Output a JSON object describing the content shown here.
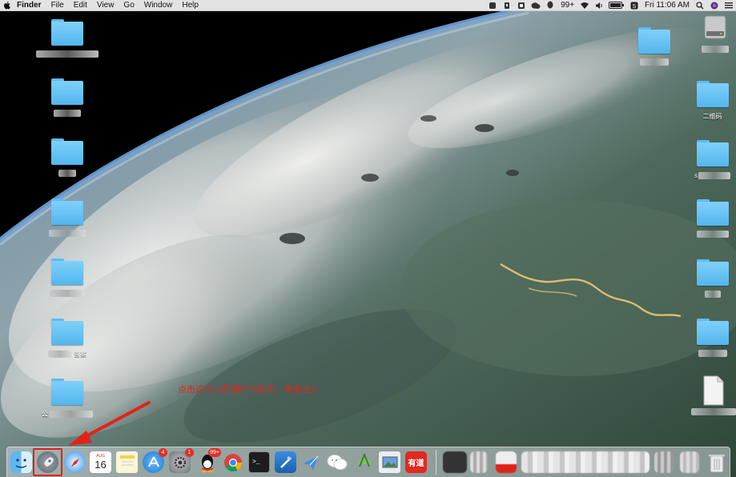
{
  "menubar": {
    "apple_icon": "apple-logo-icon",
    "app_name": "Finder",
    "menus": [
      "File",
      "Edit",
      "View",
      "Go",
      "Window",
      "Help"
    ],
    "status": {
      "notification_count": "99+",
      "battery": "",
      "clock": "Fri 11:06 AM"
    }
  },
  "desktop": {
    "left_icons": [
      {
        "label": ""
      },
      {
        "label": ""
      },
      {
        "label": ""
      },
      {
        "label": ""
      },
      {
        "label": ""
      },
      {
        "label": "备案"
      },
      {
        "label": "公"
      }
    ],
    "right_icons": [
      {
        "label": ""
      },
      {
        "label": "二维码"
      },
      {
        "label": "s"
      },
      {
        "label": ""
      },
      {
        "label": ""
      },
      {
        "label": ""
      },
      {
        "label": ""
      }
    ],
    "hard_drive_icon": "hard-drive-icon"
  },
  "annotation": {
    "text": "点击这个火箭图标的选项，单击进入",
    "color": "#e8231b"
  },
  "dock": {
    "calendar": {
      "month": "AUG",
      "day": "16"
    },
    "badges": {
      "app_store": "4",
      "system_prefs": "1",
      "qq": "99+"
    },
    "youdao_label": "有道"
  }
}
